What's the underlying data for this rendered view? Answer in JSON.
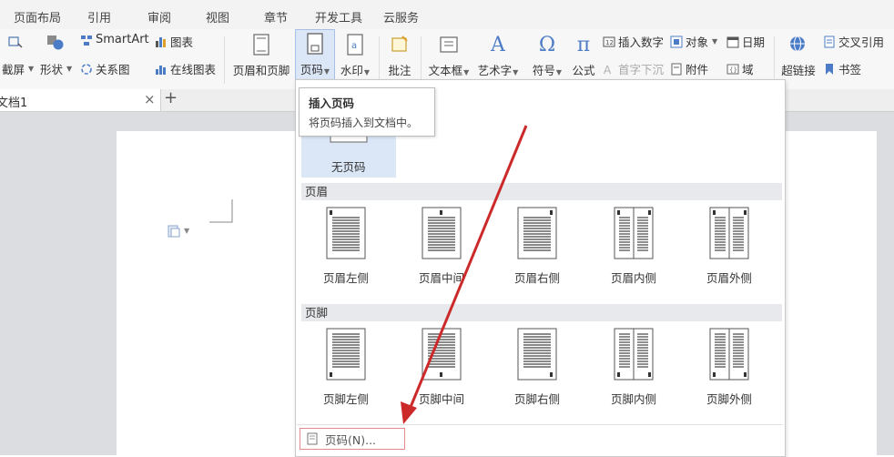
{
  "menu_tabs": [
    "页面布局",
    "引用",
    "审阅",
    "视图",
    "章节",
    "开发工具",
    "云服务"
  ],
  "ribbon": {
    "screenshot": "截屏",
    "shape": "形状",
    "smartart": "SmartArt",
    "chart": "图表",
    "relation_chart": "关系图",
    "online_chart": "在线图表",
    "header_footer": "页眉和页脚",
    "page_number": "页码",
    "watermark": "水印",
    "comment": "批注",
    "textbox": "文本框",
    "wordart": "艺术字",
    "symbol": "符号",
    "formula": "公式",
    "insert_number": "插入数字",
    "dropcap": "首字下沉",
    "object": "对象",
    "attachment": "附件",
    "date": "日期",
    "field": "域",
    "hyperlink": "超链接",
    "cross_ref": "交叉引用",
    "bookmark": "书签",
    "formula_symbol": "π",
    "symbol_glyph": "Ω",
    "wordart_glyph": "A"
  },
  "doc_tab": {
    "name": "文档1",
    "close": "×",
    "new": "+"
  },
  "tooltip": {
    "title": "插入页码",
    "desc": "将页码插入到文档中。"
  },
  "dropdown": {
    "no_page_number": "无页码",
    "header_section": "页眉",
    "header_options": [
      "页眉左侧",
      "页眉中间",
      "页眉右侧",
      "页眉内侧",
      "页眉外侧"
    ],
    "footer_section": "页脚",
    "footer_options": [
      "页脚左侧",
      "页脚中间",
      "页脚右侧",
      "页脚内侧",
      "页脚外侧"
    ],
    "page_number_dialog": "页码(N)..."
  },
  "colors": {
    "annotation_arrow": "#cc2a2a",
    "highlight": "#dbe6f7",
    "accent": "#2b579a"
  }
}
